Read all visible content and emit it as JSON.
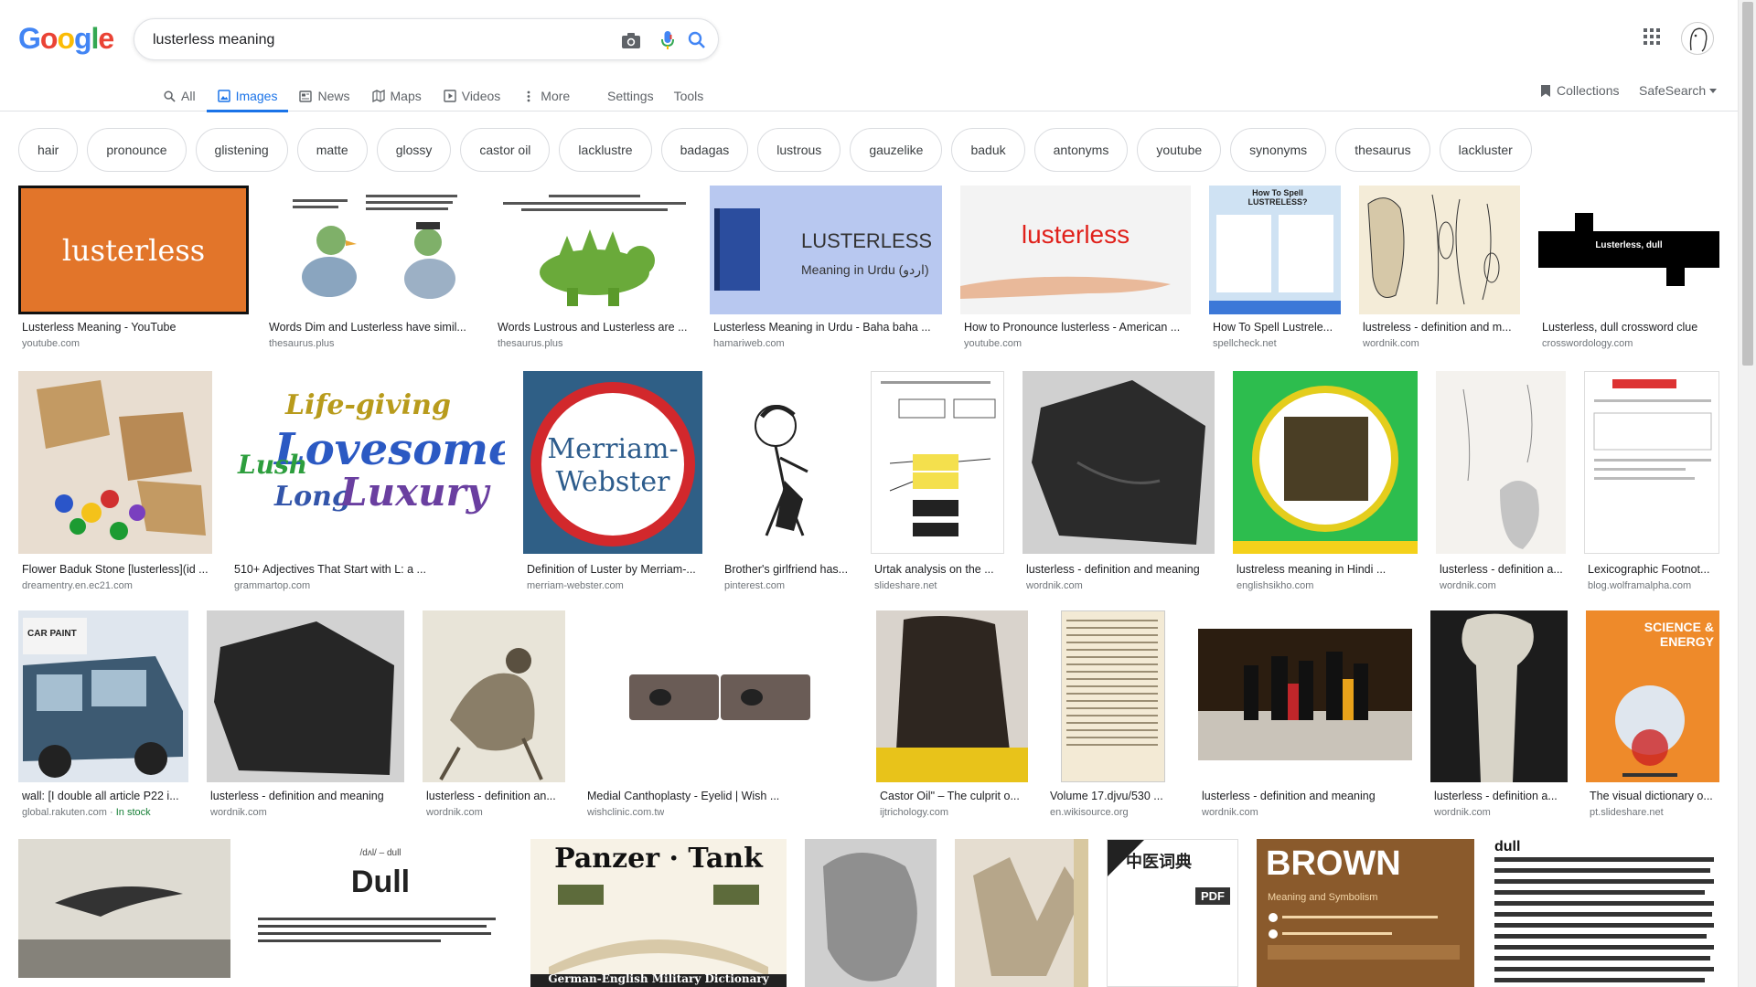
{
  "search": {
    "query": "lusterless meaning"
  },
  "header": {
    "logo_letters": [
      "G",
      "o",
      "o",
      "g",
      "l",
      "e"
    ],
    "logo_colors": [
      "#4285F4",
      "#EA4335",
      "#FBBC05",
      "#4285F4",
      "#34A853",
      "#EA4335"
    ]
  },
  "tabs": [
    {
      "label": "All",
      "icon": "search-icon",
      "active": false
    },
    {
      "label": "Images",
      "icon": "image-icon",
      "active": true
    },
    {
      "label": "News",
      "icon": "news-icon",
      "active": false
    },
    {
      "label": "Maps",
      "icon": "map-icon",
      "active": false
    },
    {
      "label": "Videos",
      "icon": "video-icon",
      "active": false
    },
    {
      "label": "More",
      "icon": "more-vert-icon",
      "active": false
    }
  ],
  "tools": {
    "settings": "Settings",
    "tools": "Tools"
  },
  "right_links": {
    "collections": "Collections",
    "safesearch": "SafeSearch"
  },
  "chips": [
    "hair",
    "pronounce",
    "glistening",
    "matte",
    "glossy",
    "castor oil",
    "lacklustre",
    "badagas",
    "lustrous",
    "gauzelike",
    "baduk",
    "antonyms",
    "youtube",
    "synonyms",
    "thesaurus",
    "lackluster"
  ],
  "results": [
    {
      "caption": "Lusterless Meaning - YouTube",
      "domain": "youtube.com"
    },
    {
      "caption": "Words Dim and Lusterless have simil...",
      "domain": "thesaurus.plus"
    },
    {
      "caption": "Words Lustrous and Lusterless are ...",
      "domain": "thesaurus.plus"
    },
    {
      "caption": "Lusterless Meaning in Urdu - Baha baha ...",
      "domain": "hamariweb.com"
    },
    {
      "caption": "How to Pronounce lusterless - American ...",
      "domain": "youtube.com"
    },
    {
      "caption": "How To Spell Lustrele...",
      "domain": "spellcheck.net"
    },
    {
      "caption": "lustreless - definition and m...",
      "domain": "wordnik.com"
    },
    {
      "caption": "Lusterless, dull crossword clue",
      "domain": "crosswordology.com"
    },
    {
      "caption": "Flower Baduk Stone [lusterless](id ...",
      "domain": "dreamentry.en.ec21.com"
    },
    {
      "caption": "510+ Adjectives That Start with L: a ...",
      "domain": "grammartop.com"
    },
    {
      "caption": "Definition of Luster by Merriam-...",
      "domain": "merriam-webster.com"
    },
    {
      "caption": "Brother's girlfriend has...",
      "domain": "pinterest.com"
    },
    {
      "caption": "Urtak analysis on the ...",
      "domain": "slideshare.net"
    },
    {
      "caption": "lusterless - definition and meaning",
      "domain": "wordnik.com"
    },
    {
      "caption": "lustreless meaning in Hindi ...",
      "domain": "englishsikho.com"
    },
    {
      "caption": "lusterless - definition a...",
      "domain": "wordnik.com"
    },
    {
      "caption": "Lexicographic Footnot...",
      "domain": "blog.wolframalpha.com"
    },
    {
      "caption": "wall: [I double all article P22 i...",
      "domain": "global.rakuten.com",
      "extra": "In stock"
    },
    {
      "caption": "lusterless - definition and meaning",
      "domain": "wordnik.com"
    },
    {
      "caption": "lusterless - definition an...",
      "domain": "wordnik.com"
    },
    {
      "caption": "Medial Canthoplasty - Eyelid | Wish ...",
      "domain": "wishclinic.com.tw"
    },
    {
      "caption": "Castor Oil\" – The culprit o...",
      "domain": "ijtrichology.com"
    },
    {
      "caption": "Volume 17.djvu/530 ...",
      "domain": "en.wikisource.org"
    },
    {
      "caption": "lusterless - definition and meaning",
      "domain": "wordnik.com"
    },
    {
      "caption": "lusterless - definition a...",
      "domain": "wordnik.com"
    },
    {
      "caption": "The visual dictionary o...",
      "domain": "pt.slideshare.net"
    }
  ],
  "thumb_text": {
    "lusterless": "lusterless",
    "urdu_title": "LUSTERLESS",
    "urdu_sub": "Meaning in Urdu (اردو)",
    "red_word": "lusterless",
    "spell_title": "How To Spell LUSTRELESS?",
    "crossword": "Lusterless, dull",
    "lovesome": "Lovesome",
    "life": "Life-giving",
    "luxury": "Luxury",
    "long": "Long",
    "lush": "Lush",
    "mw1": "Merriam-",
    "mw2": "Webster",
    "van": "CAR PAINT",
    "dull": "Dull",
    "dull_phon": "/dʌl/ – dull",
    "panzer": "Panzer · Tank",
    "panzer_sub": "German-English Military Dictionary",
    "brown": "BROWN",
    "brown_sub": "Meaning and Symbolism",
    "pdf": "PDF",
    "chinese": "中医词典",
    "dict_title": "dull",
    "sci": "SCIENCE & ENERGY"
  }
}
